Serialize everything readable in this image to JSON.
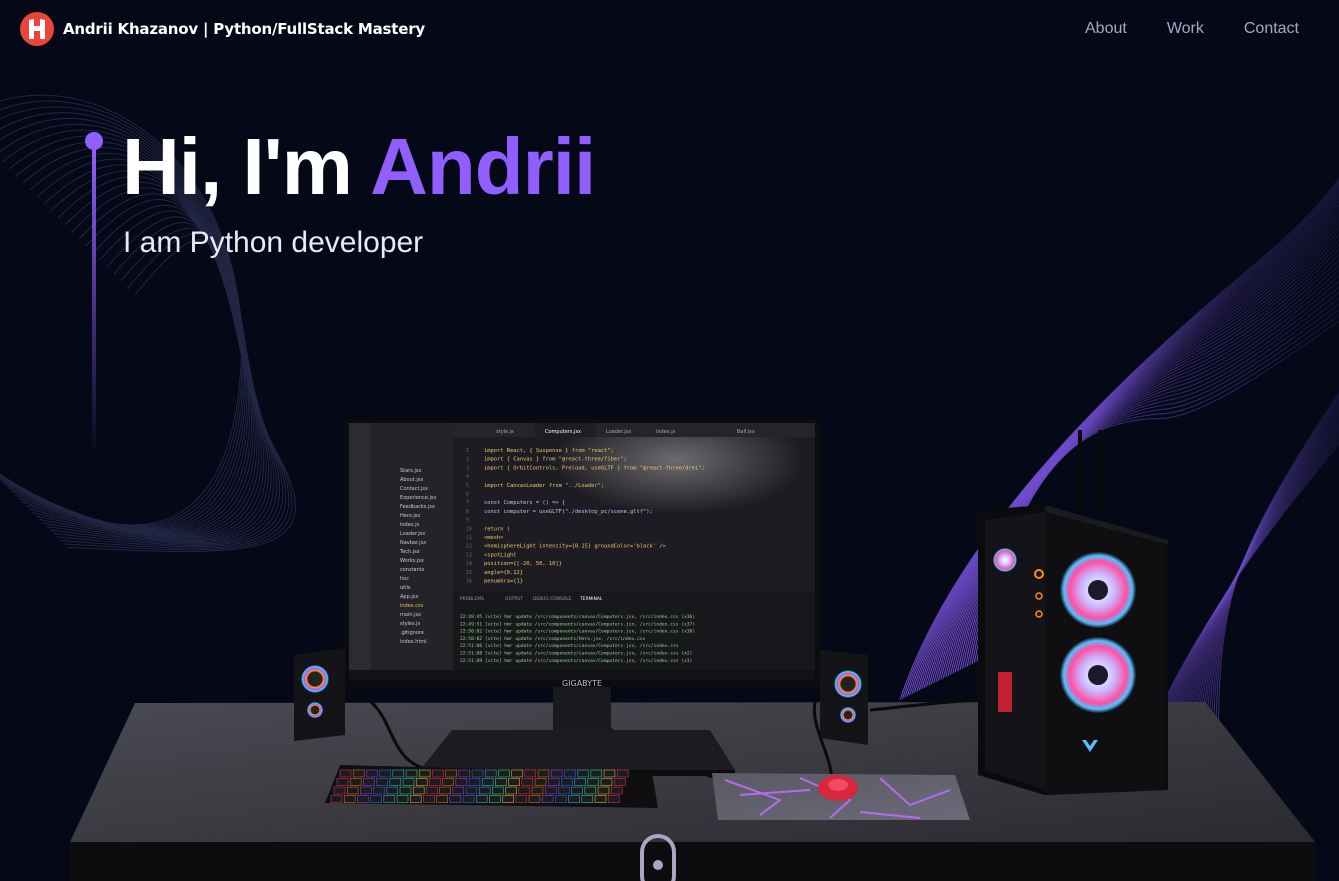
{
  "navbar": {
    "brand": "Andrii Khazanov | Python/FullStack Mastery",
    "links": [
      "About",
      "Work",
      "Contact"
    ]
  },
  "hero": {
    "greeting": "Hi, I'm ",
    "name": "Andrii",
    "subtitle": "I am Python developer"
  },
  "monitor": {
    "brand_label": "GIGABYTE",
    "tabs": [
      "style.js",
      "Computers.jsx",
      "Loader.jsx",
      "index.js",
      "Ball.jsx"
    ],
    "code_lines": [
      "import React, { Suspense } from \"react\";",
      "import { Canvas } from \"@react-three/fiber\";",
      "import { OrbitControls, Preload, useGLTF } from \"@react-three/drei\";",
      "",
      "import CanvasLoader from \"../Loader\";",
      "",
      "const Computers = () => {",
      "  const computer = useGLTF(\"./desktop_pc/scene.gltf\");",
      "",
      "  return (",
      "    <mesh>",
      "      <hemisphereLight intensity={0.15} groundColor='black' />",
      "      <spotLight",
      "        position={[-20, 50, 10]}",
      "        angle={0.12}",
      "        penumbra={1}"
    ],
    "terminal_tabs": [
      "PROBLEMS",
      "OUTPUT",
      "DEBUG CONSOLE",
      "TERMINAL"
    ],
    "terminal_lines": [
      "22:49:45 [vite] hmr update /src/components/canvas/Computers.jsx, /src/index.css (x36)",
      "22:49:51 [vite] hmr update /src/components/canvas/Computers.jsx, /src/index.css (x37)",
      "22:50:02 [vite] hmr update /src/components/canvas/Computers.jsx, /src/index.css (x38)",
      "22:50:02 [vite] hmr update /src/components/Hero.jsx, /src/index.css",
      "22:51:06 [vite] hmr update /src/components/canvas/Computers.jsx, /src/index.css",
      "22:51:08 [vite] hmr update /src/components/canvas/Computers.jsx, /src/index.css (x2)",
      "22:51:09 [vite] hmr update /src/components/canvas/Computers.jsx, /src/index.css (x3)"
    ],
    "files": [
      "Stars.jsx",
      "About.jsx",
      "Contact.jsx",
      "Experience.jsx",
      "Feedbacks.jsx",
      "Hero.jsx",
      "index.js",
      "Loader.jsx",
      "Navbar.jsx",
      "Tech.jsx",
      "Works.jsx",
      "constants",
      "hoc",
      "utils",
      "App.jsx",
      "index.css",
      "main.jsx",
      "styles.js",
      ".gitignore",
      "index.html"
    ]
  },
  "colors": {
    "accent": "#915eff",
    "background": "#050816",
    "nav_text": "#aaa6c3",
    "logo": "#e8453c"
  }
}
